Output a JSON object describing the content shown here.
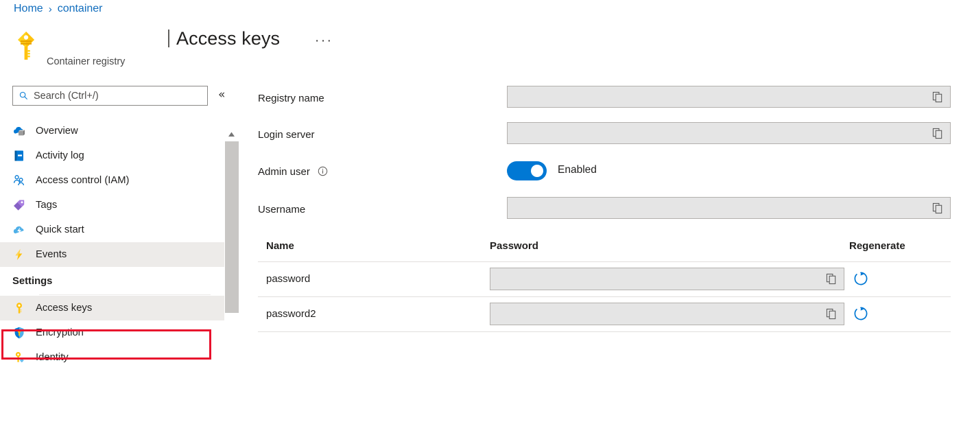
{
  "breadcrumb": {
    "items": [
      {
        "label": "Home",
        "name": "breadcrumb-home"
      },
      {
        "label": "container",
        "name": "breadcrumb-container"
      }
    ],
    "separator": "›"
  },
  "header": {
    "icon": "key-icon",
    "subtitle": "Container registry",
    "title": "Access keys",
    "ellipsis": "···"
  },
  "sidebar": {
    "search": {
      "placeholder": "Search (Ctrl+/)",
      "icon": "search-icon"
    },
    "collapse": "«",
    "items": [
      {
        "label": "Overview",
        "icon": "overview-cloud-icon",
        "selected": false
      },
      {
        "label": "Activity log",
        "icon": "activity-log-icon",
        "selected": false
      },
      {
        "label": "Access control (IAM)",
        "icon": "access-control-icon",
        "selected": false
      },
      {
        "label": "Tags",
        "icon": "tag-icon",
        "selected": false
      },
      {
        "label": "Quick start",
        "icon": "quick-start-icon",
        "selected": false
      },
      {
        "label": "Events",
        "icon": "events-bolt-icon",
        "selected": true
      }
    ],
    "section_label": "Settings",
    "settings_items": [
      {
        "label": "Access keys",
        "icon": "access-keys-key-icon",
        "selected": true,
        "annotated": true
      },
      {
        "label": "Encryption",
        "icon": "encryption-shield-icon",
        "selected": false,
        "annotated": false
      },
      {
        "label": "Identity",
        "icon": "identity-key-icon",
        "selected": false,
        "annotated": false
      }
    ]
  },
  "main": {
    "fields": [
      {
        "label": "Registry name",
        "value": "",
        "copy_icon": "copy-icon",
        "type": "text"
      },
      {
        "label": "Login server",
        "value": "",
        "copy_icon": "copy-icon",
        "type": "text"
      },
      {
        "label": "Admin user",
        "value": "",
        "info_icon": "info-icon",
        "type": "toggle",
        "toggle_state": "Enabled",
        "toggle_on": true
      },
      {
        "label": "Username",
        "value": "",
        "copy_icon": "copy-icon",
        "type": "text"
      }
    ],
    "table": {
      "columns": [
        "Name",
        "Password",
        "Regenerate"
      ],
      "rows": [
        {
          "name": "password",
          "password": "",
          "copy_icon": "copy-icon",
          "regenerate_icon": "regenerate-icon"
        },
        {
          "name": "password2",
          "password": "",
          "copy_icon": "copy-icon",
          "regenerate_icon": "regenerate-icon"
        }
      ]
    }
  },
  "colors": {
    "link": "#0f6cbd",
    "accent": "#0078d4",
    "annotation": "#e8112d",
    "selected_bg": "#edebe9",
    "input_bg": "#e5e5e5",
    "key_yellow": "#ffc20e"
  }
}
